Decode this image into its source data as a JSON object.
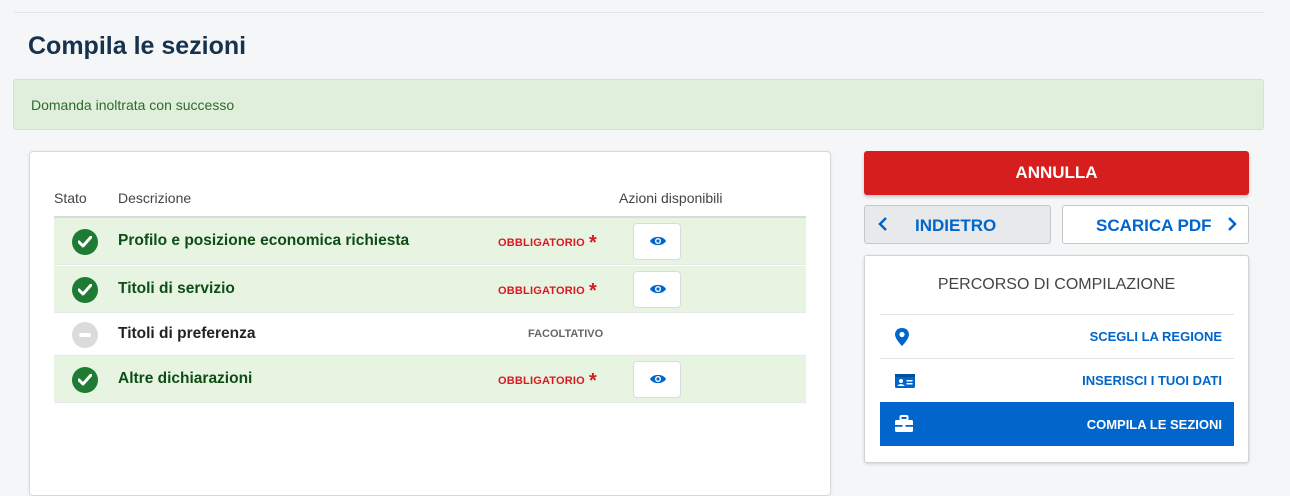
{
  "page": {
    "title": "Compila le sezioni"
  },
  "alert": {
    "text": "Domanda inoltrata con successo"
  },
  "table": {
    "headers": {
      "stato": "Stato",
      "descrizione": "Descrizione",
      "azioni": "Azioni disponibili"
    },
    "rows": [
      {
        "description": "Profilo e posizione economica richiesta",
        "tag": "OBBLIGATORIO",
        "star": "*",
        "status": "completed"
      },
      {
        "description": "Titoli di servizio",
        "tag": "OBBLIGATORIO",
        "star": "*",
        "status": "completed"
      },
      {
        "description": "Titoli di preferenza",
        "tag": "FACOLTATIVO",
        "status": "not-filled"
      },
      {
        "description": "Altre dichiarazioni",
        "tag": "OBBLIGATORIO",
        "star": "*",
        "status": "completed"
      }
    ]
  },
  "actions": {
    "annulla": "ANNULLA",
    "indietro": "INDIETRO",
    "scarica_pdf": "SCARICA PDF"
  },
  "percorso": {
    "title": "PERCORSO DI COMPILAZIONE",
    "steps": [
      {
        "label": "SCEGLI LA REGIONE",
        "icon": "map-pin-icon"
      },
      {
        "label": "INSERISCI I TUOI DATI",
        "icon": "id-card-icon"
      },
      {
        "label": "COMPILA LE SEZIONI",
        "icon": "briefcase-icon",
        "active": true
      }
    ]
  },
  "colors": {
    "primary": "#0066cc",
    "danger": "#d71e1e",
    "success_bg": "#e6f4e1",
    "success_text": "#0f4d17",
    "alert_bg": "#e0efdc"
  }
}
